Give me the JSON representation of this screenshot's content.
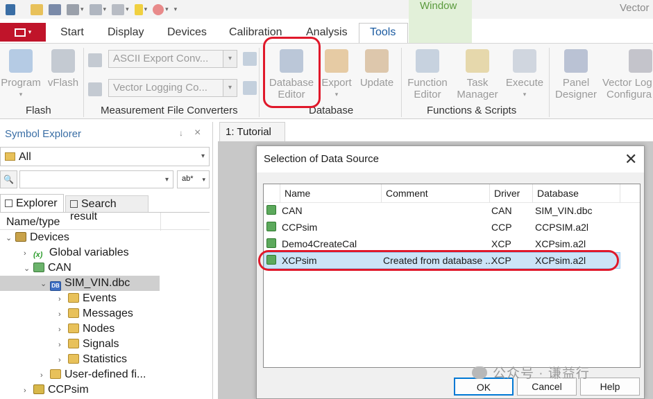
{
  "quick_access": {
    "window_tab": "Window",
    "app_title": "Vector"
  },
  "ribbon_tabs": [
    "Start",
    "Display",
    "Devices",
    "Calibration",
    "Analysis",
    "Tools"
  ],
  "active_tab": "Tools",
  "ribbon": {
    "flash": {
      "program": "Program",
      "vflash": "vFlash",
      "group": "Flash"
    },
    "converters": {
      "combo1": "ASCII Export Conv...",
      "combo2": "Vector Logging Co...",
      "group": "Measurement File Converters"
    },
    "database": {
      "editor_line1": "Database",
      "editor_line2": "Editor",
      "export": "Export",
      "update": "Update",
      "group": "Database"
    },
    "functions": {
      "fe_line1": "Function",
      "fe_line2": "Editor",
      "tm_line1": "Task",
      "tm_line2": "Manager",
      "execute": "Execute",
      "group": "Functions & Scripts"
    },
    "panel": {
      "line1": "Panel",
      "line2": "Designer"
    },
    "logger": {
      "line1": "Vector Log",
      "line2": "Configura"
    },
    "colors": {
      "highlight_red": "#e0182a",
      "file_button": "#c0142a",
      "window_tab_bg": "#e2f0d9"
    }
  },
  "symbol_explorer": {
    "title": "Symbol Explorer",
    "pin": "↓",
    "close": "×",
    "filter_value": "All",
    "search_value": "",
    "regex_label": "ab*",
    "tabs": [
      "Explorer",
      "Search result"
    ],
    "column_header": "Name/type",
    "tree": [
      {
        "label": "Devices",
        "expand": "⌄",
        "icon": "devices-icon"
      },
      {
        "label": "Global variables",
        "expand": "›",
        "icon": "variables-icon"
      },
      {
        "label": "CAN",
        "expand": "⌄",
        "icon": "network-icon"
      },
      {
        "label": "SIM_VIN.dbc",
        "expand": "⌄",
        "icon": "database-icon"
      },
      {
        "label": "Events",
        "expand": "›",
        "icon": "folder-icon"
      },
      {
        "label": "Messages",
        "expand": "›",
        "icon": "folder-icon"
      },
      {
        "label": "Nodes",
        "expand": "›",
        "icon": "folder-icon"
      },
      {
        "label": "Signals",
        "expand": "›",
        "icon": "folder-icon"
      },
      {
        "label": "Statistics",
        "expand": "›",
        "icon": "folder-icon"
      },
      {
        "label": "User-defined fi...",
        "expand": "›",
        "icon": "folder-icon"
      },
      {
        "label": "CCPsim",
        "expand": "›",
        "icon": "network-icon"
      }
    ]
  },
  "document": {
    "tab": "1: Tutorial"
  },
  "dialog": {
    "title": "Selection of Data Source",
    "close": "✕",
    "columns": [
      "Name",
      "Comment",
      "Driver",
      "Database"
    ],
    "rows": [
      {
        "name": "CAN",
        "comment": "",
        "driver": "CAN",
        "database": "SIM_VIN.dbc"
      },
      {
        "name": "CCPsim",
        "comment": "",
        "driver": "CCP",
        "database": "CCPSIM.a2l"
      },
      {
        "name": "Demo4CreateCal",
        "comment": "",
        "driver": "XCP",
        "database": "XCPsim.a2l"
      },
      {
        "name": "XCPsim",
        "comment": "Created from database ...",
        "driver": "XCP",
        "database": "XCPsim.a2l"
      }
    ],
    "selected_row": "XCPsim",
    "ok": "OK",
    "cancel": "Cancel",
    "help": "Help"
  },
  "watermark": "公众号 · 谦益行"
}
